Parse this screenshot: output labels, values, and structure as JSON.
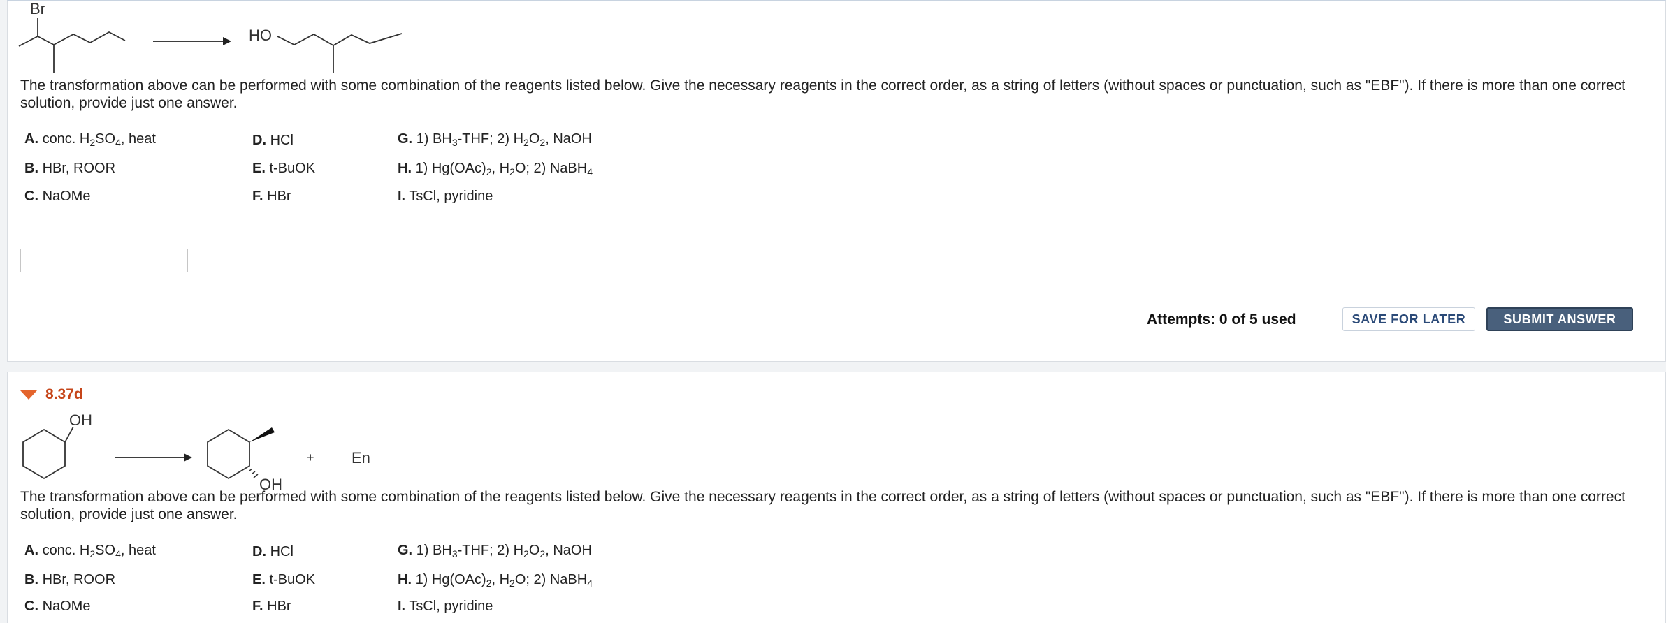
{
  "question1": {
    "scheme": {
      "reactant_label": "Br",
      "product_label": "HO"
    },
    "instructions": "The transformation above can be performed with some combination of the reagents listed below. Give the necessary reagents in the correct order, as a string of letters (without spaces or punctuation, such as \"EBF\"). If there is more than one correct solution, provide just one answer.",
    "answer_value": "",
    "attempts_text": "Attempts: 0 of 5 used",
    "save_label": "SAVE FOR LATER",
    "submit_label": "SUBMIT ANSWER"
  },
  "question2": {
    "number": "8.37d",
    "scheme": {
      "reactant_label": "OH",
      "product_label": "OH",
      "plus": "+",
      "byproduct_label": "En"
    },
    "instructions": "The transformation above can be performed with some combination of the reagents listed below. Give the necessary reagents in the correct order, as a string of letters (without spaces or punctuation, such as \"EBF\"). If there is more than one correct solution, provide just one answer."
  },
  "reagents": [
    {
      "letter": "A.",
      "parts": [
        "conc. H",
        "2",
        "SO",
        "4",
        ", heat"
      ]
    },
    {
      "letter": "B.",
      "parts": [
        "HBr, ROOR"
      ]
    },
    {
      "letter": "C.",
      "parts": [
        "NaOMe"
      ]
    },
    {
      "letter": "D.",
      "parts": [
        "HCl"
      ]
    },
    {
      "letter": "E.",
      "parts": [
        "t-BuOK"
      ]
    },
    {
      "letter": "F.",
      "parts": [
        "HBr"
      ]
    },
    {
      "letter": "G.",
      "parts": [
        "1) BH",
        "3",
        "-THF; 2) H",
        "2",
        "O",
        "2",
        ", NaOH"
      ]
    },
    {
      "letter": "H.",
      "parts": [
        "1) Hg(OAc)",
        "2",
        ", H",
        "2",
        "O; 2) NaBH",
        "4"
      ]
    },
    {
      "letter": "I.",
      "parts": [
        "TsCl, pyridine"
      ]
    }
  ],
  "colors": {
    "accent_orange": "#e4642c",
    "question_number": "#c6461a",
    "submit_bg": "#49607c",
    "save_text": "#2b4a78"
  },
  "icons": {
    "collapse": "caret-down-icon"
  }
}
